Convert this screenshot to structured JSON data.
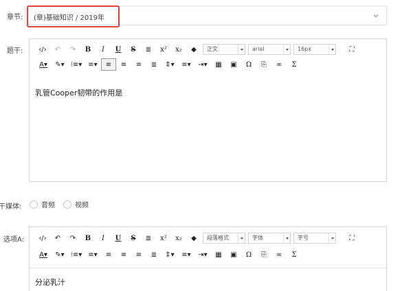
{
  "chapter": {
    "label": "章节:",
    "value": "(章)基础知识 / 2019年"
  },
  "stem": {
    "label": "题干:",
    "toolbar": {
      "paragraph_format": "正文",
      "font_family": "arial",
      "font_size": "16px"
    },
    "content": "乳管Cooper韧带的作用是"
  },
  "stem_media": {
    "label": "干媒体:",
    "options": [
      "音频",
      "视频"
    ]
  },
  "option_a": {
    "label": "选项A:",
    "toolbar": {
      "paragraph_format": "段落格式",
      "font_family": "字体",
      "font_size": "字号"
    },
    "content": "分泌乳汁"
  }
}
